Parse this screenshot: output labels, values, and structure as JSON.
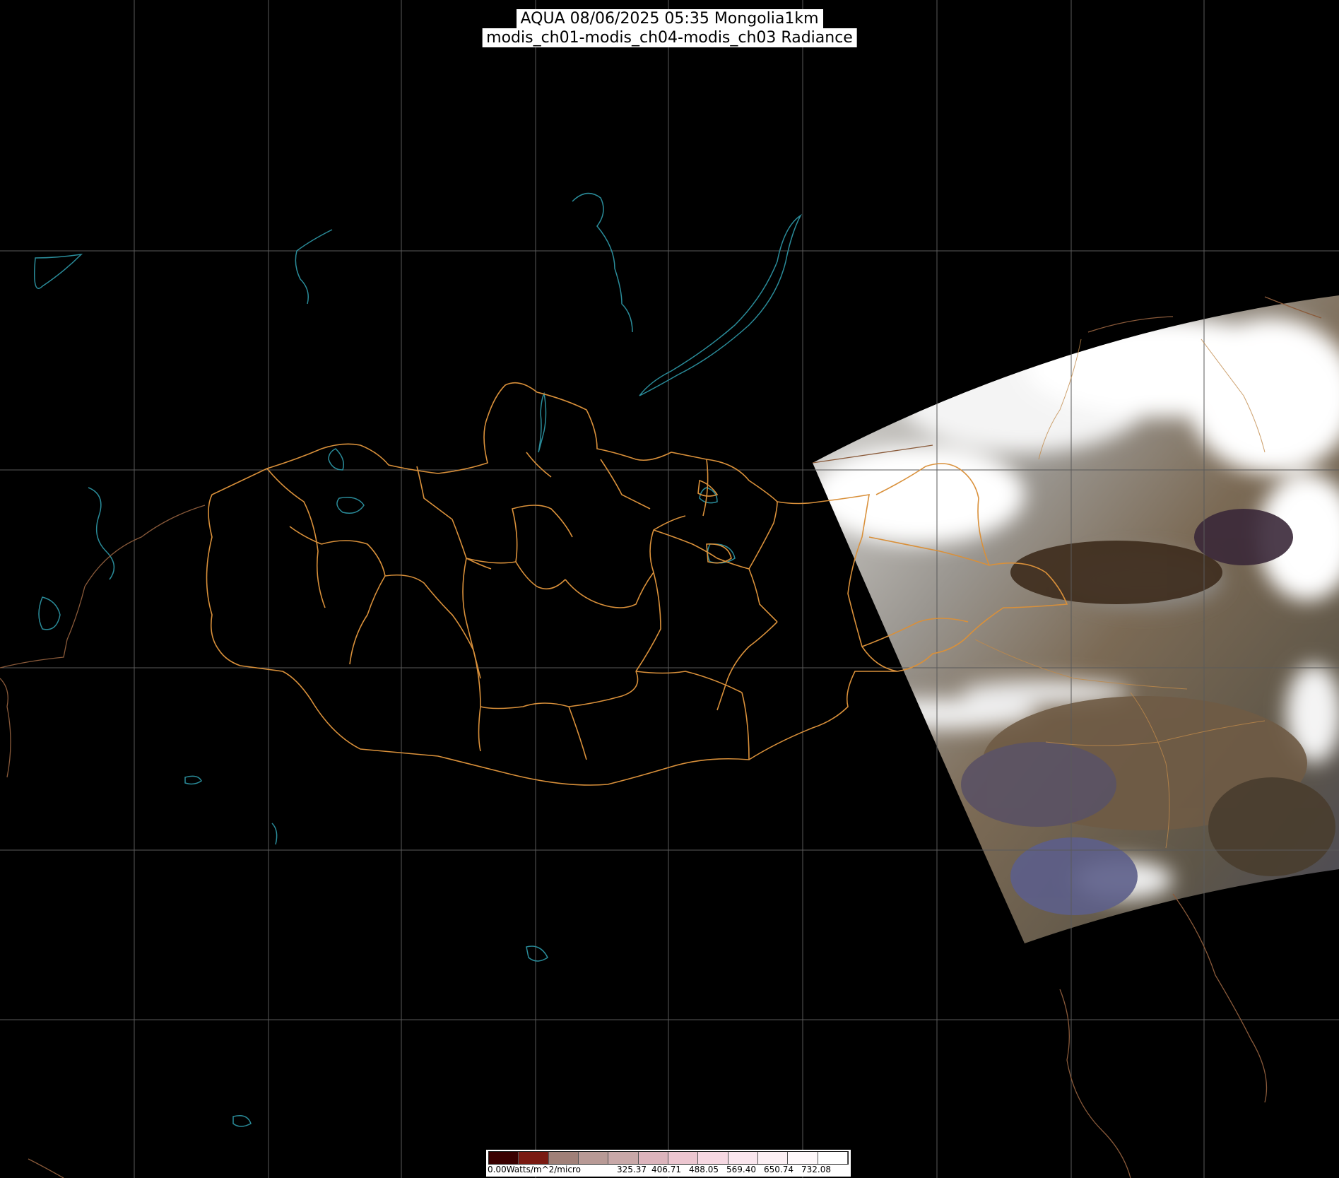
{
  "title": {
    "line1": "AQUA 08/06/2025 05:35 Mongolia1km",
    "line2": "modis_ch01-modis_ch04-modis_ch03 Radiance"
  },
  "legend": {
    "min_label": "0.00Watts/m^2/micro",
    "ticks": [
      "325.37",
      "406.71",
      "488.05",
      "569.40",
      "650.74",
      "732.08"
    ],
    "swatch_colors": [
      "#3a0000",
      "#7a1a12",
      "#a08078",
      "#b89a96",
      "#c8a8a8",
      "#dcb4bc",
      "#ecc6d0",
      "#f6d8e2",
      "#fae6ee",
      "#fcf0f4",
      "#fef8fa",
      "#ffffff"
    ]
  },
  "colors": {
    "background": "#000000",
    "grid": "#5a5a5a",
    "admin_borders": "#d9903a",
    "water_outlines": "#2a8c9a",
    "country_borders": "#8a5a3a"
  }
}
